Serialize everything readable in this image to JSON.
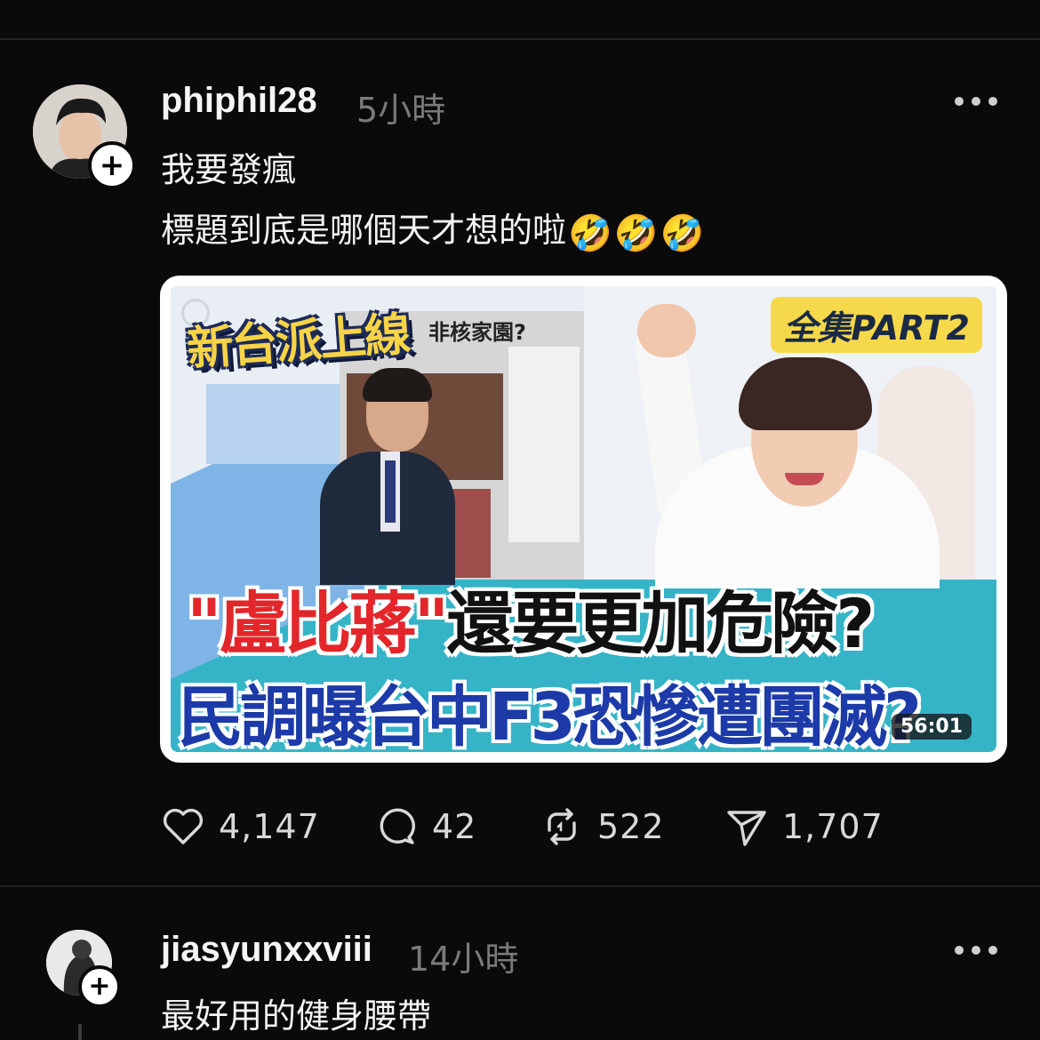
{
  "posts": [
    {
      "username": "phiphil28",
      "time": "5小時",
      "lines": [
        "我要發瘋",
        "標題到底是哪個天才想的啦"
      ],
      "emojis": [
        "🤣",
        "🤣",
        "🤣"
      ],
      "media": {
        "show_logo": "新台派上線",
        "part_badge": "全集PART2",
        "screen_header": "非核家園?",
        "headline_quote_open": "\"",
        "headline_red": "盧比蔣",
        "headline_quote_close": "\"",
        "headline_rest": "還要更加危險?",
        "headline2": "民調曝台中F3恐慘遭團滅?",
        "duration": "56:01"
      },
      "actions": {
        "likes": "4,147",
        "comments": "42",
        "reposts": "522",
        "shares": "1,707"
      }
    },
    {
      "username": "jiasyunxxviii",
      "time": "14小時",
      "lines": [
        "最好用的健身腰帶"
      ]
    }
  ],
  "icons": {
    "more": "more-horizontal-icon",
    "follow": "plus-icon",
    "like": "heart-icon",
    "comment": "comment-bubble-icon",
    "repost": "repost-icon",
    "share": "send-icon"
  },
  "colors": {
    "background": "#0a0a0a",
    "text": "#f3f3f3",
    "muted": "#7a7a7a",
    "divider": "#232323"
  }
}
